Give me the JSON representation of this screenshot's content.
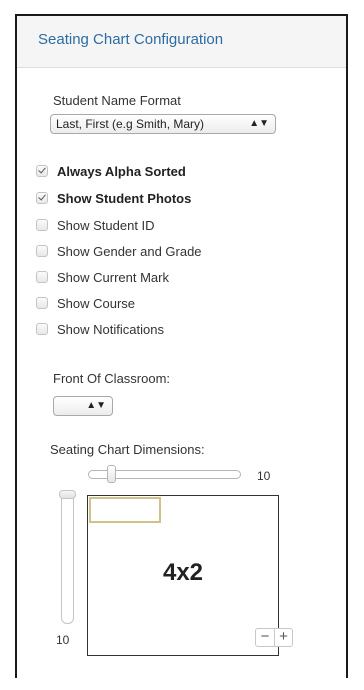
{
  "panel": {
    "title": "Seating Chart Configuration"
  },
  "student_name_format": {
    "label": "Student Name Format",
    "selected": "Last, First (e.g Smith, Mary)"
  },
  "options": [
    {
      "label": "Always Alpha Sorted",
      "checked": true
    },
    {
      "label": "Show Student Photos",
      "checked": true
    },
    {
      "label": "Show Student ID",
      "checked": false
    },
    {
      "label": "Show Gender and Grade",
      "checked": false
    },
    {
      "label": "Show Current Mark",
      "checked": false
    },
    {
      "label": "Show Course",
      "checked": false
    },
    {
      "label": "Show Notifications",
      "checked": false
    }
  ],
  "front_of_classroom": {
    "label": "Front Of Classroom:",
    "selected": ""
  },
  "dimensions": {
    "label": "Seating Chart Dimensions:",
    "columns_max": "10",
    "rows_max": "10",
    "grid_label": "4x2",
    "zoom_out": "−",
    "zoom_in": "+"
  },
  "icons": {
    "select_arrows": "updown-arrows-icon",
    "checkmark": "checkmark-icon"
  },
  "colors": {
    "header_text": "#2d6ca2",
    "seat_border": "#cfc38a"
  }
}
